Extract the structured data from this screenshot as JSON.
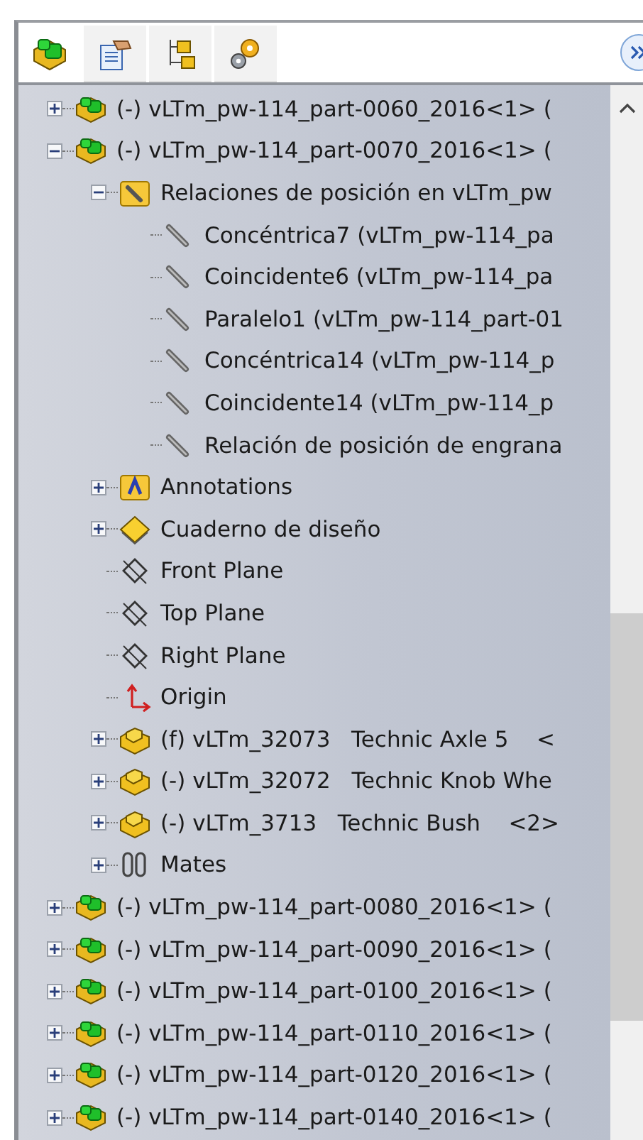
{
  "tabs": [
    {
      "kind": "feature-tree",
      "selected": true
    },
    {
      "kind": "property",
      "selected": false
    },
    {
      "kind": "configuration",
      "selected": false
    },
    {
      "kind": "display",
      "selected": false
    }
  ],
  "tree": [
    {
      "kind": "assembly",
      "label": "(-) vLTm_pw-114_part-0060_2016<1> (",
      "expanded": false
    },
    {
      "kind": "assembly",
      "label": "(-) vLTm_pw-114_part-0070_2016<1> (",
      "expanded": true,
      "children": [
        {
          "kind": "mate-folder",
          "label": "Relaciones de posición en vLTm_pw",
          "expanded": true,
          "children": [
            {
              "kind": "mate",
              "label": "Concéntrica7 (vLTm_pw-114_pa"
            },
            {
              "kind": "mate",
              "label": "Coincidente6 (vLTm_pw-114_pa"
            },
            {
              "kind": "mate",
              "label": "Paralelo1 (vLTm_pw-114_part-01"
            },
            {
              "kind": "mate",
              "label": "Concéntrica14 (vLTm_pw-114_p"
            },
            {
              "kind": "mate",
              "label": "Coincidente14 (vLTm_pw-114_p"
            },
            {
              "kind": "mate",
              "label": "Relación de posición de engrana"
            }
          ]
        },
        {
          "kind": "annotations",
          "label": "Annotations",
          "expanded": false
        },
        {
          "kind": "design-binder",
          "label": "Cuaderno de diseño",
          "expanded": false
        },
        {
          "kind": "plane",
          "label": "Front Plane"
        },
        {
          "kind": "plane",
          "label": "Top Plane"
        },
        {
          "kind": "plane",
          "label": "Right Plane"
        },
        {
          "kind": "origin",
          "label": "Origin"
        },
        {
          "kind": "part",
          "label": "(f) vLTm_32073   Technic Axle 5    <",
          "expanded": false
        },
        {
          "kind": "part",
          "label": "(-) vLTm_32072   Technic Knob Whe",
          "expanded": false
        },
        {
          "kind": "part",
          "label": "(-) vLTm_3713   Technic Bush    <2>",
          "expanded": false
        },
        {
          "kind": "mates",
          "label": "Mates",
          "expanded": false
        }
      ]
    },
    {
      "kind": "assembly",
      "label": "(-) vLTm_pw-114_part-0080_2016<1> (",
      "expanded": false
    },
    {
      "kind": "assembly",
      "label": "(-) vLTm_pw-114_part-0090_2016<1> (",
      "expanded": false
    },
    {
      "kind": "assembly",
      "label": "(-) vLTm_pw-114_part-0100_2016<1> (",
      "expanded": false
    },
    {
      "kind": "assembly",
      "label": "(-) vLTm_pw-114_part-0110_2016<1> (",
      "expanded": false
    },
    {
      "kind": "assembly",
      "label": "(-) vLTm_pw-114_part-0120_2016<1> (",
      "expanded": false
    },
    {
      "kind": "assembly",
      "label": "(-) vLTm_pw-114_part-0140_2016<1> (",
      "expanded": false
    }
  ]
}
